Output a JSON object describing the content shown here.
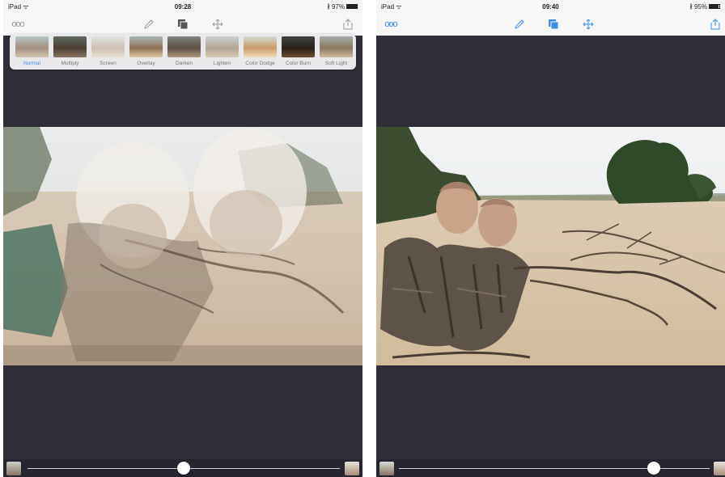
{
  "left_screen": {
    "status": {
      "carrier": "iPad ᯤ",
      "time": "09:28",
      "battery": "97%",
      "battery_level": 0.97
    },
    "more_icon": "ooo",
    "blend_modes": [
      "Normal",
      "Multiply",
      "Screen",
      "Overlay",
      "Darken",
      "Lighten",
      "Color Dodge",
      "Color Burn",
      "Soft Light"
    ],
    "selected_blend": "Normal",
    "opacity": 0.5
  },
  "right_screen": {
    "status": {
      "carrier": "iPad ᯤ",
      "time": "09:40",
      "battery": "95%",
      "battery_level": 0.95
    },
    "more_icon": "ooo",
    "opacity": 0.82
  },
  "colors": {
    "accent": "#3d8ee8",
    "canvas": "#2f2e38",
    "bottom_bar": "#272630"
  },
  "icons": [
    "more-icon",
    "pencil-icon",
    "layers-icon",
    "move-icon",
    "share-icon",
    "bluetooth-icon",
    "battery-icon"
  ]
}
